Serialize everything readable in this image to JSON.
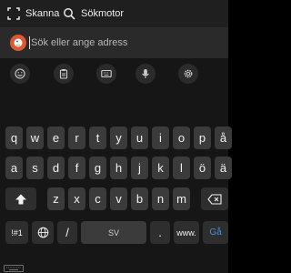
{
  "top_bar": {
    "scan_label": "Skanna",
    "search_engine_label": "Sökmotor"
  },
  "search": {
    "placeholder": "Sök eller ange adress",
    "brand_color": "#de5833"
  },
  "toolbar": {
    "icons": [
      "emoji-icon",
      "clipboard-icon",
      "keyboard-icon",
      "microphone-icon",
      "settings-icon"
    ]
  },
  "keyboard": {
    "row1": [
      "q",
      "w",
      "e",
      "r",
      "t",
      "y",
      "u",
      "i",
      "o",
      "p",
      "å"
    ],
    "row2": [
      "a",
      "s",
      "d",
      "f",
      "g",
      "h",
      "j",
      "k",
      "l",
      "ö",
      "ä"
    ],
    "row3": [
      "z",
      "x",
      "c",
      "v",
      "b",
      "n",
      "m"
    ],
    "symbols_label": "!#1",
    "slash_label": "/",
    "space_label": "SV",
    "dot_label": ".",
    "www_label": "www.",
    "go_label": "Gå",
    "accent_color": "#4a8fe0"
  }
}
